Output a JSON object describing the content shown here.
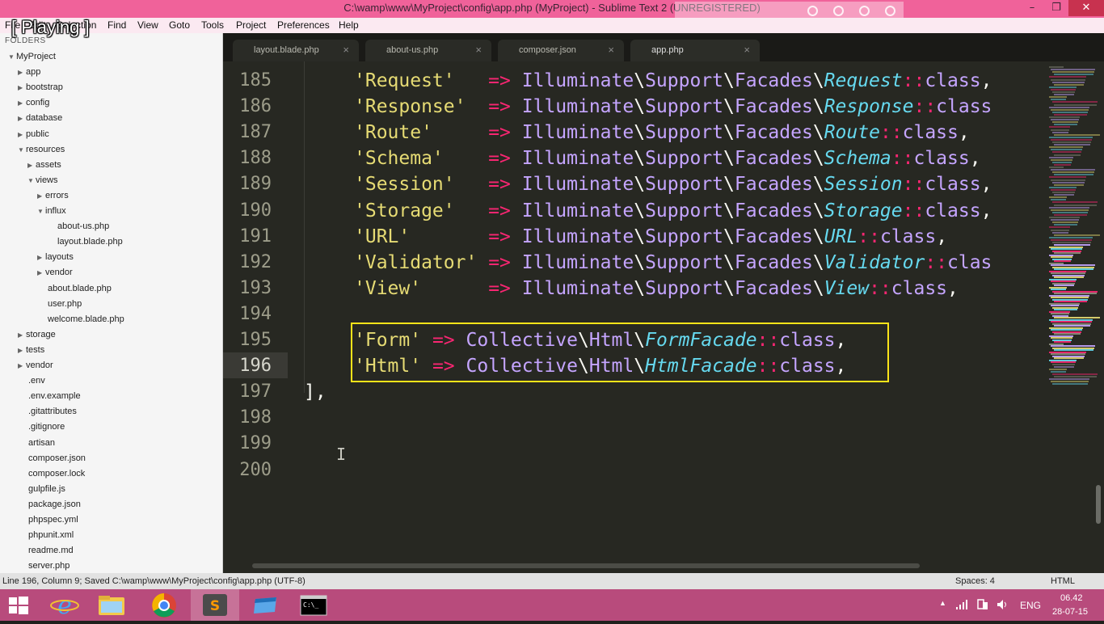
{
  "window": {
    "title": "C:\\wamp\\www\\MyProject\\config\\app.php (MyProject) - Sublime Text 2 (UNREGISTERED)",
    "minimize_glyph": "–",
    "maximize_glyph": "❐",
    "close_glyph": "✕"
  },
  "overlay": {
    "playing_label": "[ Playing ]"
  },
  "menu": {
    "items": [
      "File",
      "Edit",
      "Selection",
      "Find",
      "View",
      "Goto",
      "Tools",
      "Project",
      "Preferences",
      "Help"
    ]
  },
  "sidebar": {
    "header": "FOLDERS",
    "items": [
      {
        "label": "MyProject",
        "level": 0,
        "expanded": true
      },
      {
        "label": "app",
        "level": 1,
        "expanded": false
      },
      {
        "label": "bootstrap",
        "level": 1,
        "expanded": false
      },
      {
        "label": "config",
        "level": 1,
        "expanded": false
      },
      {
        "label": "database",
        "level": 1,
        "expanded": false
      },
      {
        "label": "public",
        "level": 1,
        "expanded": false
      },
      {
        "label": "resources",
        "level": 1,
        "expanded": true
      },
      {
        "label": "assets",
        "level": 2,
        "expanded": false
      },
      {
        "label": "views",
        "level": 2,
        "expanded": true
      },
      {
        "label": "errors",
        "level": 3,
        "expanded": false
      },
      {
        "label": "influx",
        "level": 3,
        "expanded": true
      },
      {
        "label": "about-us.php",
        "level": 4,
        "file": true
      },
      {
        "label": "layout.blade.php",
        "level": 4,
        "file": true
      },
      {
        "label": "layouts",
        "level": 3,
        "expanded": false
      },
      {
        "label": "vendor",
        "level": 3,
        "expanded": false
      },
      {
        "label": "about.blade.php",
        "level": 3,
        "file": true
      },
      {
        "label": "user.php",
        "level": 3,
        "file": true
      },
      {
        "label": "welcome.blade.php",
        "level": 3,
        "file": true
      },
      {
        "label": "storage",
        "level": 1,
        "expanded": false
      },
      {
        "label": "tests",
        "level": 1,
        "expanded": false
      },
      {
        "label": "vendor",
        "level": 1,
        "expanded": false
      },
      {
        "label": ".env",
        "level": 1,
        "file": true
      },
      {
        "label": ".env.example",
        "level": 1,
        "file": true
      },
      {
        "label": ".gitattributes",
        "level": 1,
        "file": true
      },
      {
        "label": ".gitignore",
        "level": 1,
        "file": true
      },
      {
        "label": "artisan",
        "level": 1,
        "file": true
      },
      {
        "label": "composer.json",
        "level": 1,
        "file": true
      },
      {
        "label": "composer.lock",
        "level": 1,
        "file": true
      },
      {
        "label": "gulpfile.js",
        "level": 1,
        "file": true
      },
      {
        "label": "package.json",
        "level": 1,
        "file": true
      },
      {
        "label": "phpspec.yml",
        "level": 1,
        "file": true
      },
      {
        "label": "phpunit.xml",
        "level": 1,
        "file": true
      },
      {
        "label": "readme.md",
        "level": 1,
        "file": true
      },
      {
        "label": "server.php",
        "level": 1,
        "file": true
      }
    ]
  },
  "tabs": [
    {
      "label": "layout.blade.php",
      "active": false
    },
    {
      "label": "about-us.php",
      "active": false
    },
    {
      "label": "composer.json",
      "active": false
    },
    {
      "label": "app.php",
      "active": true
    }
  ],
  "tab_close_glyph": "×",
  "editor": {
    "line_numbers": [
      "185",
      "186",
      "187",
      "188",
      "189",
      "190",
      "191",
      "192",
      "193",
      "194",
      "195",
      "196",
      "197",
      "198",
      "199",
      "200"
    ],
    "current_line": "196",
    "facades": [
      {
        "key": "'Request'",
        "pad": "   ",
        "cls": "Request",
        "tail": "::class,"
      },
      {
        "key": "'Response'",
        "pad": "  ",
        "cls": "Response",
        "tail": "::class"
      },
      {
        "key": "'Route'",
        "pad": "     ",
        "cls": "Route",
        "tail": "::class,"
      },
      {
        "key": "'Schema'",
        "pad": "    ",
        "cls": "Schema",
        "tail": "::class,"
      },
      {
        "key": "'Session'",
        "pad": "   ",
        "cls": "Session",
        "tail": "::class,"
      },
      {
        "key": "'Storage'",
        "pad": "   ",
        "cls": "Storage",
        "tail": "::class,"
      },
      {
        "key": "'URL'",
        "pad": "       ",
        "cls": "URL",
        "tail": "::class,"
      },
      {
        "key": "'Validator'",
        "pad": " ",
        "cls": "Validator",
        "tail": "::clas"
      },
      {
        "key": "'View'",
        "pad": "      ",
        "cls": "View",
        "tail": "::class,"
      }
    ],
    "ns_prefix": [
      "Illuminate",
      "Support",
      "Facades"
    ],
    "collective": [
      {
        "key": "'Form'",
        "cls": "FormFacade",
        "tail": "::class,"
      },
      {
        "key": "'Html'",
        "cls": "HtmlFacade",
        "tail": "::class,"
      }
    ],
    "collective_ns": [
      "Collective",
      "Html"
    ],
    "arrow": "=>",
    "backslash": "\\",
    "closing": "],"
  },
  "status": {
    "left": "Line 196, Column 9; Saved C:\\wamp\\www\\MyProject\\config\\app.php (UTF-8)",
    "spaces": "Spaces: 4",
    "syntax": "HTML"
  },
  "taskbar": {
    "apps": [
      "start",
      "internet-explorer",
      "file-explorer",
      "chrome",
      "sublime-text",
      "window-manager",
      "command-prompt"
    ],
    "language": "ENG",
    "time": "06.42",
    "date": "28-07-15"
  },
  "colors": {
    "titlebar": "#f0629a",
    "taskbar": "#b84b7c",
    "editor_bg": "#272822",
    "highlight_box": "#ffe419"
  }
}
